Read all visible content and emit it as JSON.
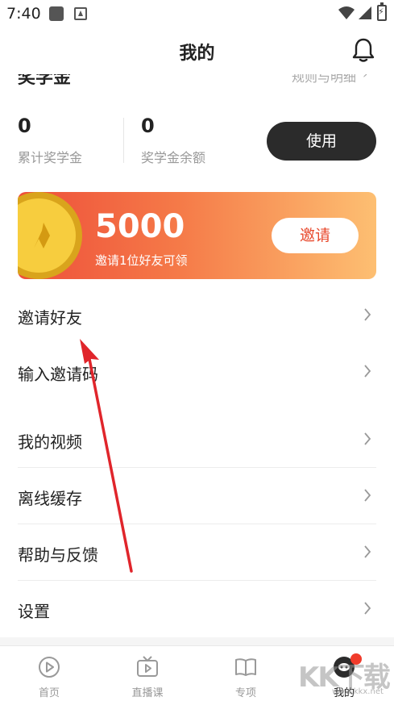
{
  "status_bar": {
    "time": "7:40"
  },
  "header": {
    "title": "我的"
  },
  "scholarship": {
    "title": "奖学金",
    "rules_link": "规则与明细",
    "chevron": "›",
    "accumulated_value": "0",
    "accumulated_label": "累计奖学金",
    "balance_value": "0",
    "balance_label": "奖学金余额",
    "use_label": "使用"
  },
  "invite_banner": {
    "amount": "5000",
    "description": "邀请1位好友可领",
    "button_label": "邀请"
  },
  "menu": {
    "invite_friends": "邀请好友",
    "enter_code": "输入邀请码",
    "my_videos": "我的视频",
    "offline_cache": "离线缓存",
    "help_feedback": "帮助与反馈",
    "settings": "设置"
  },
  "tabbar": {
    "items": [
      {
        "label": "首页",
        "icon": "play-circle-icon"
      },
      {
        "label": "直播课",
        "icon": "tv-play-icon"
      },
      {
        "label": "专项",
        "icon": "open-book-icon"
      },
      {
        "label": "我的",
        "icon": "profile-avatar-icon"
      }
    ]
  },
  "watermark": {
    "text": "KK下载",
    "url": "www.kkx.net"
  },
  "colors": {
    "accent": "#e84a2e",
    "banner_start": "#ee4f3a",
    "banner_end": "#fdbf72",
    "dark_button": "#2b2b2b",
    "badge": "#f03b2b",
    "annotation_arrow": "#e0252b"
  }
}
